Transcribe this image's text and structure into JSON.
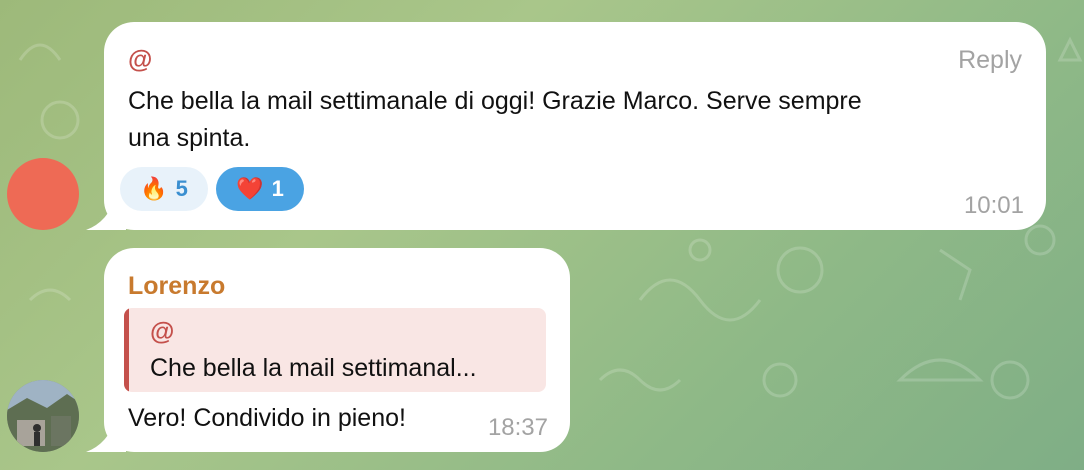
{
  "messages": [
    {
      "sender": "@",
      "reply_label": "Reply",
      "text_line1": "Che bella la mail settimanale di oggi! Grazie Marco. Serve sempre",
      "text_line2": "una spinta.",
      "reactions": [
        {
          "emoji": "🔥",
          "count": "5"
        },
        {
          "emoji": "❤️",
          "count": "1"
        }
      ],
      "time": "10:01"
    },
    {
      "sender": "Lorenzo",
      "quote": {
        "author": "@",
        "text": "Che bella la mail settimanal..."
      },
      "text": "Vero! Condivido in pieno!",
      "time": "18:37"
    }
  ],
  "colors": {
    "sender_at": "#c4504b",
    "sender_lorenzo": "#c87a2e",
    "reaction_blue": "#4aa3e3",
    "reaction_light": "#e8f2fa",
    "avatar_red": "#ee6a55"
  }
}
